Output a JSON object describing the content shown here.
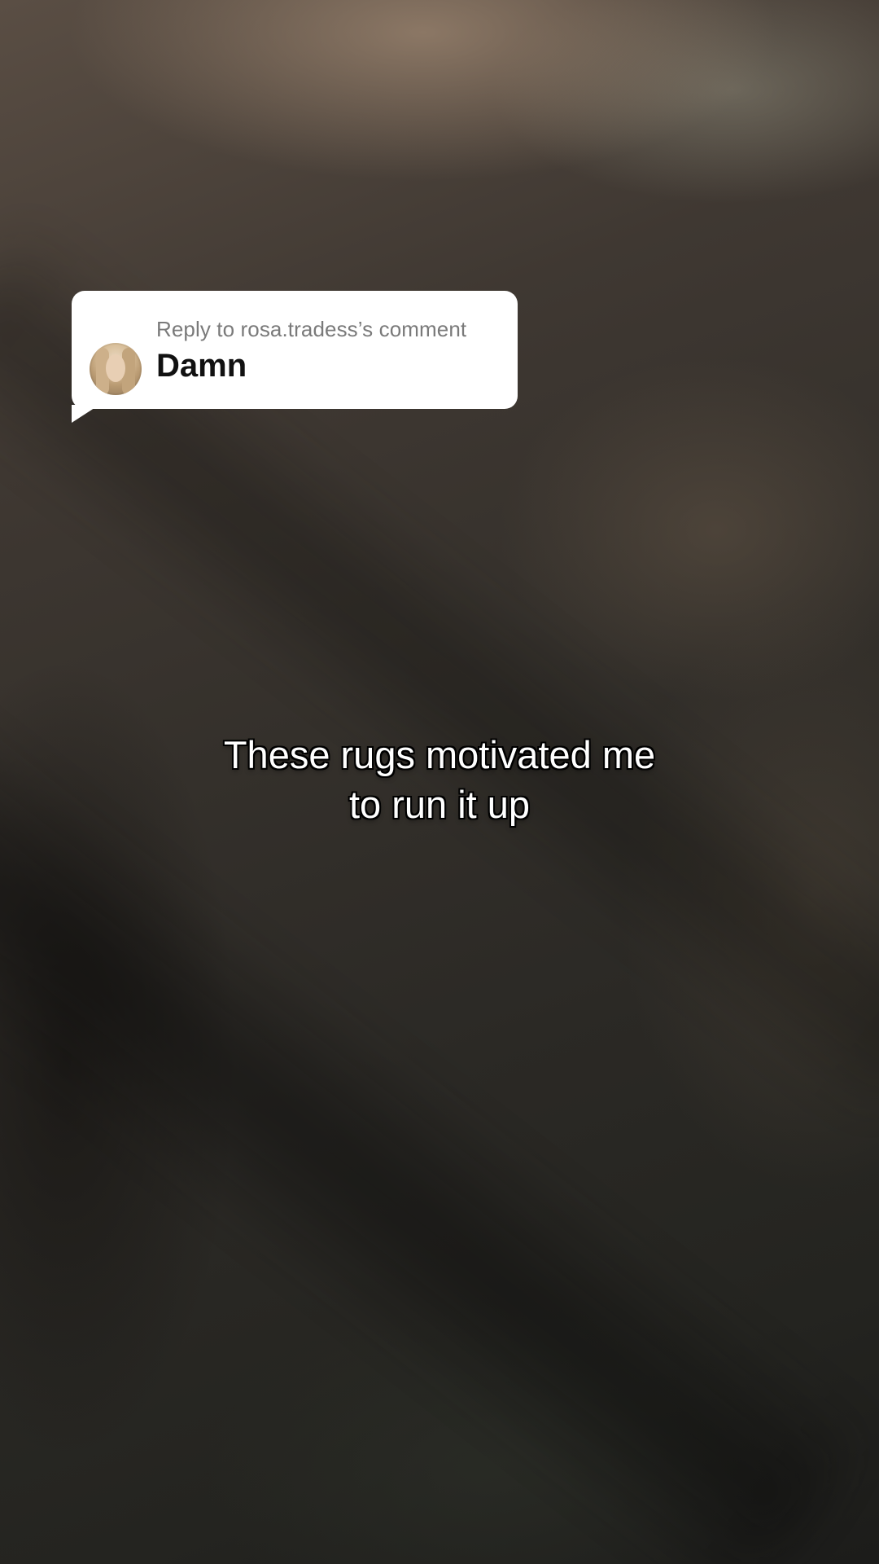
{
  "reply": {
    "label": "Reply to rosa.tradess’s comment",
    "comment": "Damn"
  },
  "caption": {
    "lines": [
      "These rugs motivated me",
      "to run it up"
    ]
  }
}
